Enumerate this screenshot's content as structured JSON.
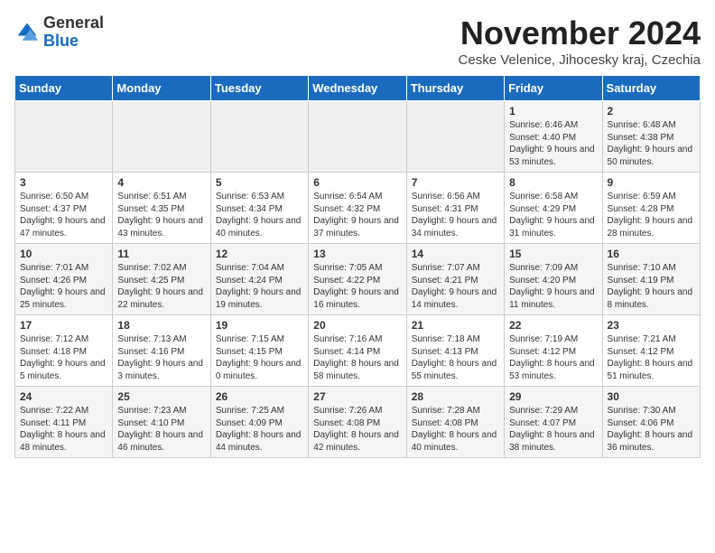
{
  "logo": {
    "general": "General",
    "blue": "Blue"
  },
  "title": "November 2024",
  "subtitle": "Ceske Velenice, Jihocesky kraj, Czechia",
  "headers": [
    "Sunday",
    "Monday",
    "Tuesday",
    "Wednesday",
    "Thursday",
    "Friday",
    "Saturday"
  ],
  "weeks": [
    [
      {
        "day": "",
        "content": ""
      },
      {
        "day": "",
        "content": ""
      },
      {
        "day": "",
        "content": ""
      },
      {
        "day": "",
        "content": ""
      },
      {
        "day": "",
        "content": ""
      },
      {
        "day": "1",
        "content": "Sunrise: 6:46 AM\nSunset: 4:40 PM\nDaylight: 9 hours and 53 minutes."
      },
      {
        "day": "2",
        "content": "Sunrise: 6:48 AM\nSunset: 4:38 PM\nDaylight: 9 hours and 50 minutes."
      }
    ],
    [
      {
        "day": "3",
        "content": "Sunrise: 6:50 AM\nSunset: 4:37 PM\nDaylight: 9 hours and 47 minutes."
      },
      {
        "day": "4",
        "content": "Sunrise: 6:51 AM\nSunset: 4:35 PM\nDaylight: 9 hours and 43 minutes."
      },
      {
        "day": "5",
        "content": "Sunrise: 6:53 AM\nSunset: 4:34 PM\nDaylight: 9 hours and 40 minutes."
      },
      {
        "day": "6",
        "content": "Sunrise: 6:54 AM\nSunset: 4:32 PM\nDaylight: 9 hours and 37 minutes."
      },
      {
        "day": "7",
        "content": "Sunrise: 6:56 AM\nSunset: 4:31 PM\nDaylight: 9 hours and 34 minutes."
      },
      {
        "day": "8",
        "content": "Sunrise: 6:58 AM\nSunset: 4:29 PM\nDaylight: 9 hours and 31 minutes."
      },
      {
        "day": "9",
        "content": "Sunrise: 6:59 AM\nSunset: 4:28 PM\nDaylight: 9 hours and 28 minutes."
      }
    ],
    [
      {
        "day": "10",
        "content": "Sunrise: 7:01 AM\nSunset: 4:26 PM\nDaylight: 9 hours and 25 minutes."
      },
      {
        "day": "11",
        "content": "Sunrise: 7:02 AM\nSunset: 4:25 PM\nDaylight: 9 hours and 22 minutes."
      },
      {
        "day": "12",
        "content": "Sunrise: 7:04 AM\nSunset: 4:24 PM\nDaylight: 9 hours and 19 minutes."
      },
      {
        "day": "13",
        "content": "Sunrise: 7:05 AM\nSunset: 4:22 PM\nDaylight: 9 hours and 16 minutes."
      },
      {
        "day": "14",
        "content": "Sunrise: 7:07 AM\nSunset: 4:21 PM\nDaylight: 9 hours and 14 minutes."
      },
      {
        "day": "15",
        "content": "Sunrise: 7:09 AM\nSunset: 4:20 PM\nDaylight: 9 hours and 11 minutes."
      },
      {
        "day": "16",
        "content": "Sunrise: 7:10 AM\nSunset: 4:19 PM\nDaylight: 9 hours and 8 minutes."
      }
    ],
    [
      {
        "day": "17",
        "content": "Sunrise: 7:12 AM\nSunset: 4:18 PM\nDaylight: 9 hours and 5 minutes."
      },
      {
        "day": "18",
        "content": "Sunrise: 7:13 AM\nSunset: 4:16 PM\nDaylight: 9 hours and 3 minutes."
      },
      {
        "day": "19",
        "content": "Sunrise: 7:15 AM\nSunset: 4:15 PM\nDaylight: 9 hours and 0 minutes."
      },
      {
        "day": "20",
        "content": "Sunrise: 7:16 AM\nSunset: 4:14 PM\nDaylight: 8 hours and 58 minutes."
      },
      {
        "day": "21",
        "content": "Sunrise: 7:18 AM\nSunset: 4:13 PM\nDaylight: 8 hours and 55 minutes."
      },
      {
        "day": "22",
        "content": "Sunrise: 7:19 AM\nSunset: 4:12 PM\nDaylight: 8 hours and 53 minutes."
      },
      {
        "day": "23",
        "content": "Sunrise: 7:21 AM\nSunset: 4:12 PM\nDaylight: 8 hours and 51 minutes."
      }
    ],
    [
      {
        "day": "24",
        "content": "Sunrise: 7:22 AM\nSunset: 4:11 PM\nDaylight: 8 hours and 48 minutes."
      },
      {
        "day": "25",
        "content": "Sunrise: 7:23 AM\nSunset: 4:10 PM\nDaylight: 8 hours and 46 minutes."
      },
      {
        "day": "26",
        "content": "Sunrise: 7:25 AM\nSunset: 4:09 PM\nDaylight: 8 hours and 44 minutes."
      },
      {
        "day": "27",
        "content": "Sunrise: 7:26 AM\nSunset: 4:08 PM\nDaylight: 8 hours and 42 minutes."
      },
      {
        "day": "28",
        "content": "Sunrise: 7:28 AM\nSunset: 4:08 PM\nDaylight: 8 hours and 40 minutes."
      },
      {
        "day": "29",
        "content": "Sunrise: 7:29 AM\nSunset: 4:07 PM\nDaylight: 8 hours and 38 minutes."
      },
      {
        "day": "30",
        "content": "Sunrise: 7:30 AM\nSunset: 4:06 PM\nDaylight: 8 hours and 36 minutes."
      }
    ]
  ]
}
